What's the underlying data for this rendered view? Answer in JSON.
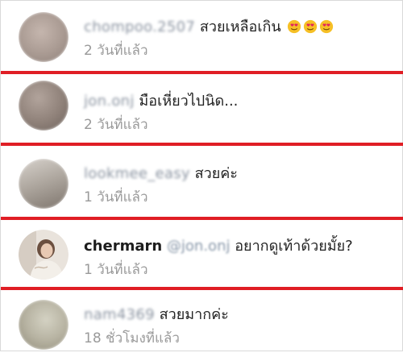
{
  "comments": [
    {
      "username": "chompoo.2507",
      "username_blurred": true,
      "text": "สวยเหลือเกิน",
      "emojis": [
        "heart-eyes-emoji",
        "heart-eyes-emoji",
        "heart-eyes-emoji"
      ],
      "time": "2 วันที่แล้ว",
      "avatar_color": "#a99a92"
    },
    {
      "username": "jon.onj",
      "username_blurred": true,
      "text": "มือเหี่ยวไปนิด...",
      "time": "2 วันที่แล้ว",
      "avatar_color": "#8f8179"
    },
    {
      "username": "lookmee_easy",
      "username_blurred": true,
      "text": "สวยค่ะ",
      "time": "1 วันที่แล้ว",
      "avatar_color": "#b0a9a1"
    },
    {
      "username": "chermarn",
      "username_blurred": false,
      "mention": "@jon.onj",
      "text": "อยากดูเท้าด้วยมั้ย?",
      "time": "1 วันที่แล้ว",
      "avatar_color": "#d8cfc6"
    },
    {
      "username": "nam4369",
      "username_blurred": true,
      "text": "สวยมากค่ะ",
      "time": "18 ชั่วโมงที่แล้ว",
      "avatar_color": "#b7b3a2"
    }
  ],
  "divider_color": "#e01e25"
}
